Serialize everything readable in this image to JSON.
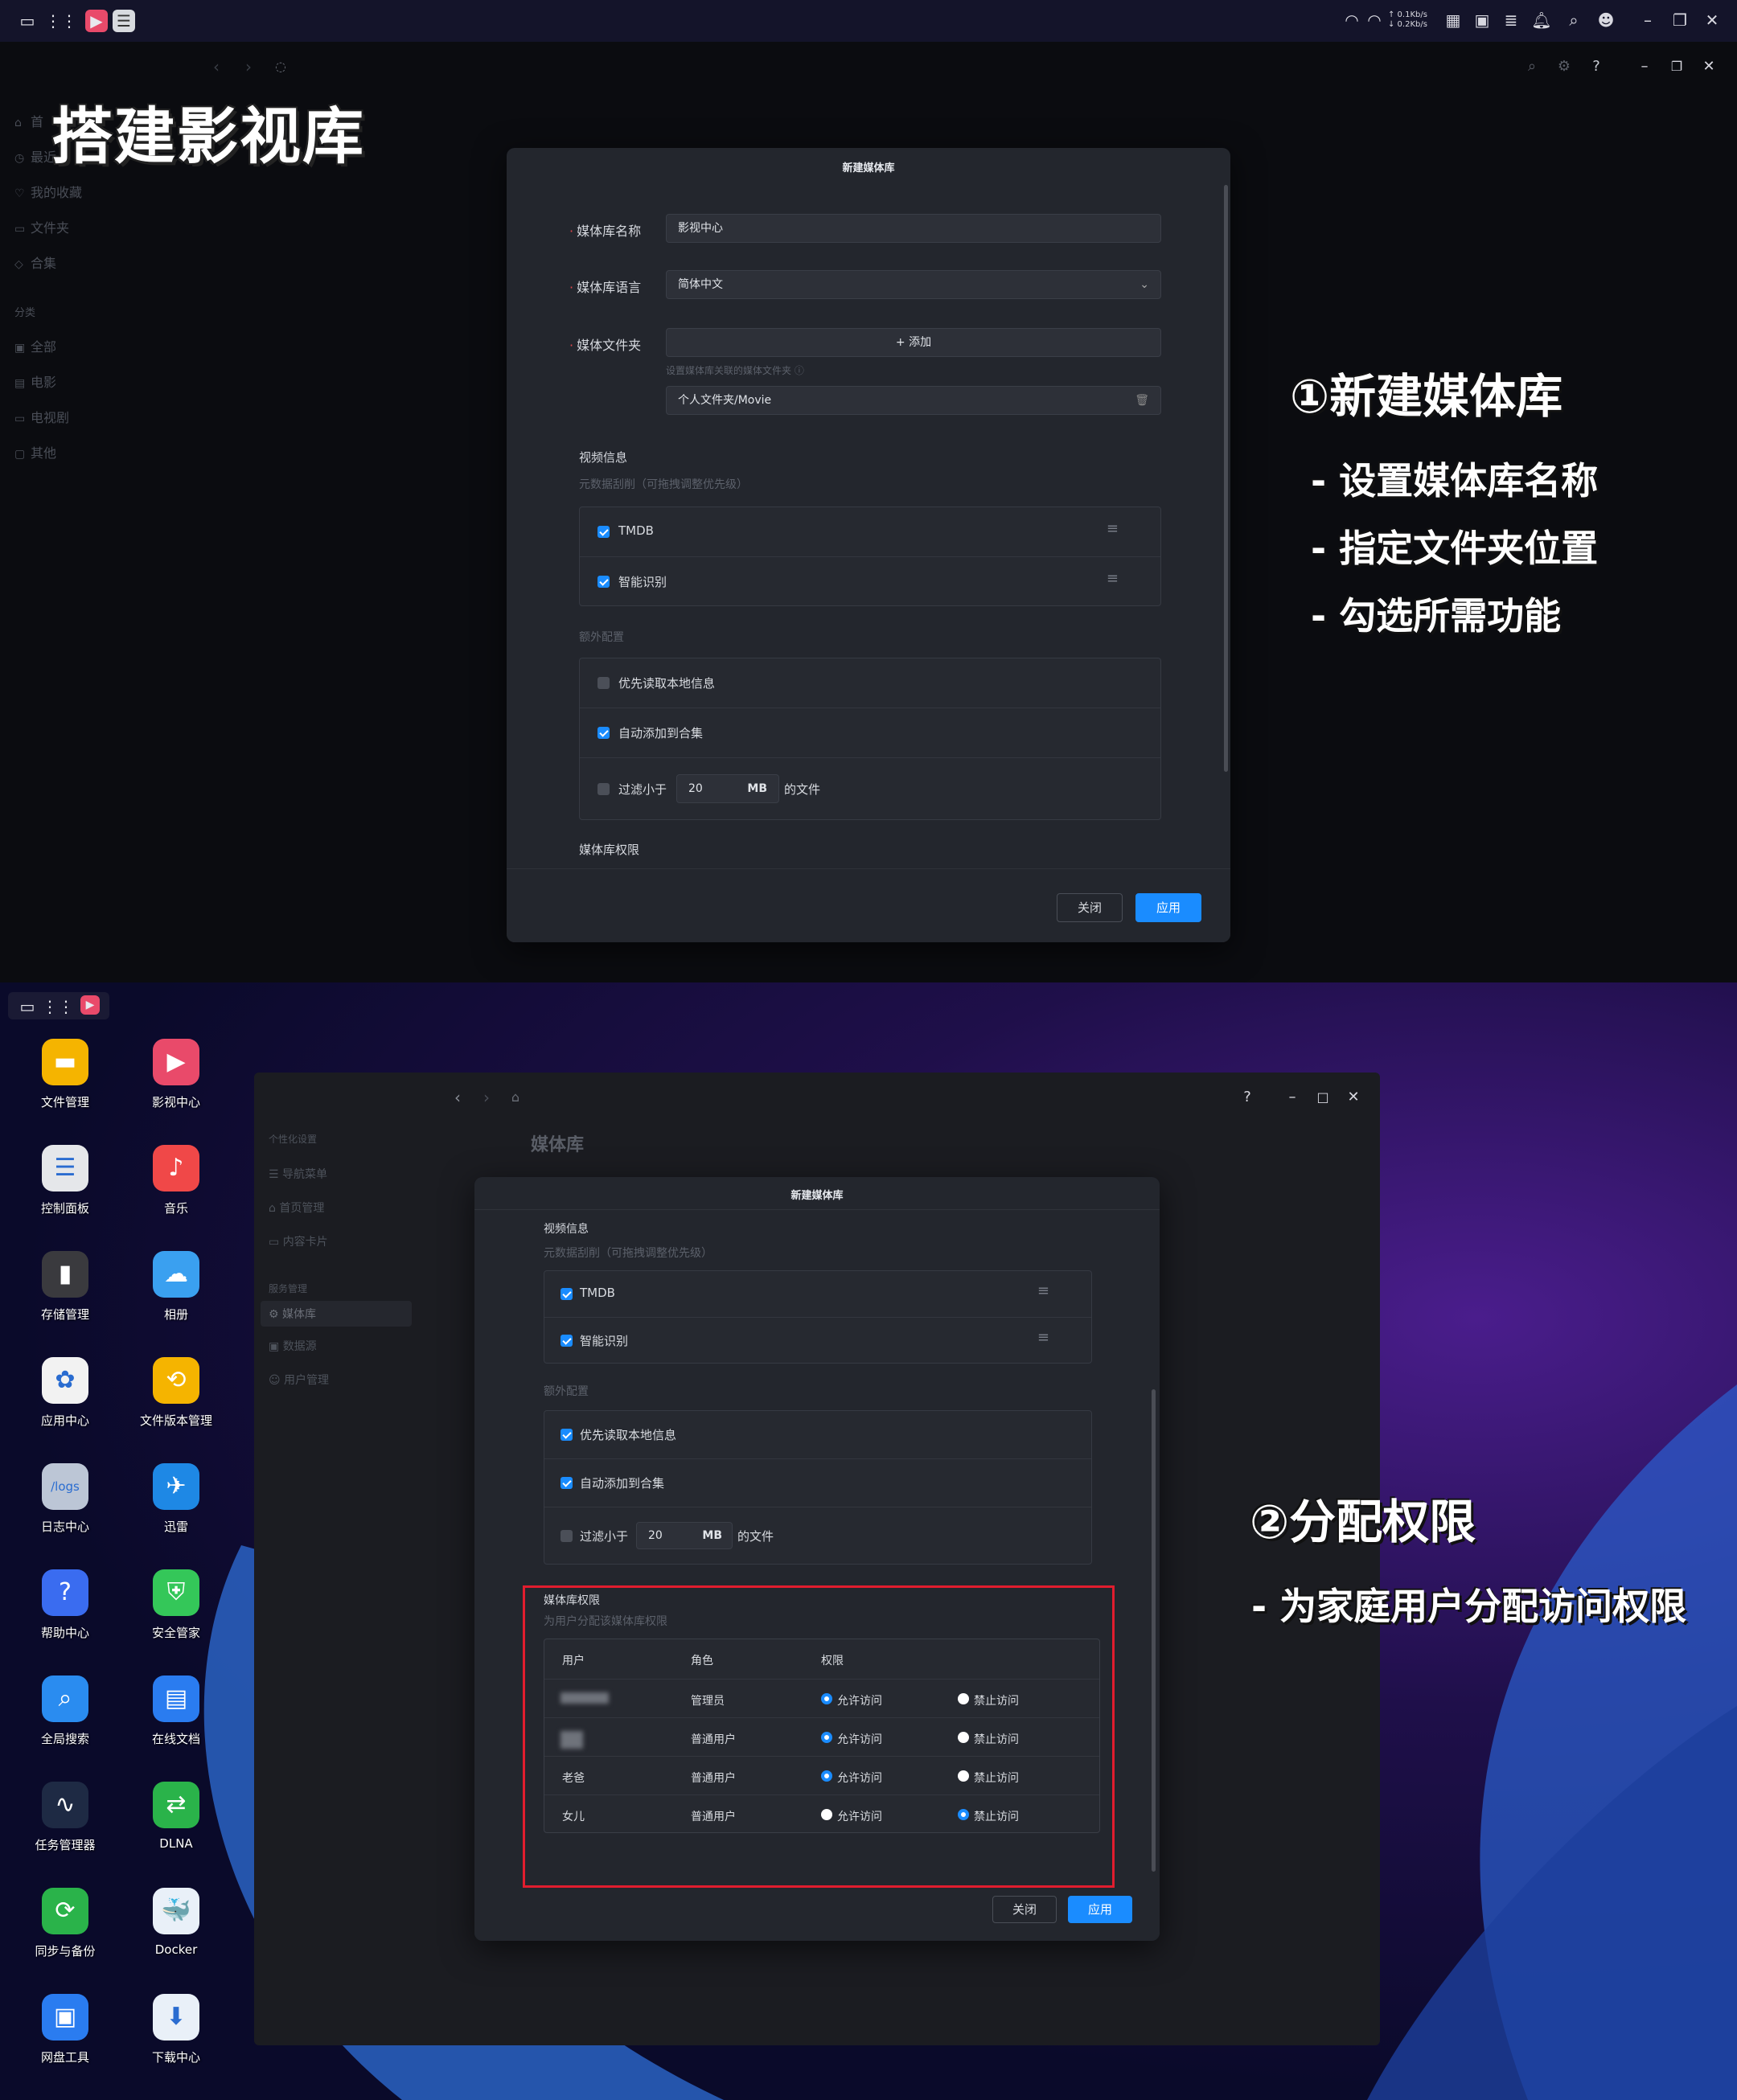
{
  "overlay": {
    "title": "搭建影视库",
    "step1_title": "①新建媒体库",
    "step1_bullets": [
      "- 设置媒体库名称",
      "- 指定文件夹位置",
      "- 勾选所需功能"
    ],
    "step2_title": "②分配权限",
    "step2_bullets": [
      "- 为家庭用户分配访问权限"
    ]
  },
  "taskbar": {
    "net_up": "↑ 0.1Kb/s",
    "net_down": "↓ 0.2Kb/s"
  },
  "panel1_sidebar": {
    "items": [
      "首",
      "最近",
      "我的收藏",
      "文件夹",
      "合集"
    ],
    "section": "分类",
    "categories": [
      "全部",
      "电影",
      "电视剧",
      "其他"
    ]
  },
  "dialog": {
    "title": "新建媒体库",
    "name_label": "媒体库名称",
    "name_value": "影视中心",
    "lang_label": "媒体库语言",
    "lang_value": "简体中文",
    "folder_label": "媒体文件夹",
    "add_label": "+ 添加",
    "folder_hint": "设置媒体库关联的媒体文件夹 ⓘ",
    "folder_path": "个人文件夹/Movie",
    "video_info": "视频信息",
    "scrape_hint": "元数据刮削（可拖拽调整优先级）",
    "scrapers": [
      {
        "label": "TMDB",
        "checked": true
      },
      {
        "label": "智能识别",
        "checked": true
      }
    ],
    "extra": "额外配置",
    "extra_items_1": [
      {
        "label": "优先读取本地信息",
        "checked": false
      },
      {
        "label": "自动添加到合集",
        "checked": true
      }
    ],
    "extra_items_2": [
      {
        "label": "优先读取本地信息",
        "checked": true
      },
      {
        "label": "自动添加到合集",
        "checked": true
      }
    ],
    "filter_prefix": "过滤小于",
    "filter_value": "20",
    "filter_unit": "MB",
    "filter_suffix": "的文件",
    "perm_title": "媒体库权限",
    "perm_sub": "为用户分配该媒体库权限",
    "close": "关闭",
    "apply": "应用"
  },
  "desktop_icons": [
    {
      "label": "文件管理",
      "icon": "folder-icon",
      "color": "#f5b400",
      "glyph": "▬"
    },
    {
      "label": "影视中心",
      "icon": "video-icon",
      "color": "#e94a6a",
      "glyph": "▶"
    },
    {
      "label": "控制面板",
      "icon": "control-panel-icon",
      "color": "#e5e7ea",
      "glyph": "☰"
    },
    {
      "label": "音乐",
      "icon": "music-icon",
      "color": "#f04848",
      "glyph": "♪"
    },
    {
      "label": "存储管理",
      "icon": "storage-icon",
      "color": "#3a3a3e",
      "glyph": "▮"
    },
    {
      "label": "相册",
      "icon": "photo-icon",
      "color": "#3aa0f0",
      "glyph": "☁"
    },
    {
      "label": "应用中心",
      "icon": "app-center-icon",
      "color": "#f2f2f2",
      "glyph": "✿"
    },
    {
      "label": "文件版本管理",
      "icon": "version-icon",
      "color": "#f5b400",
      "glyph": "⟲"
    },
    {
      "label": "日志中心",
      "icon": "log-icon",
      "color": "#bcc6d6",
      "glyph": "/logs"
    },
    {
      "label": "迅雷",
      "icon": "thunder-icon",
      "color": "#1e88e5",
      "glyph": "✈"
    },
    {
      "label": "帮助中心",
      "icon": "help-icon",
      "color": "#3a6cf0",
      "glyph": "?"
    },
    {
      "label": "安全管家",
      "icon": "security-icon",
      "color": "#34c759",
      "glyph": "⛨"
    },
    {
      "label": "全局搜索",
      "icon": "search-icon",
      "color": "#2a8cf0",
      "glyph": "⌕"
    },
    {
      "label": "在线文档",
      "icon": "doc-icon",
      "color": "#2a7cf0",
      "glyph": "▤"
    },
    {
      "label": "任务管理器",
      "icon": "task-manager-icon",
      "color": "#1e2a44",
      "glyph": "∿"
    },
    {
      "label": "DLNA",
      "icon": "dlna-icon",
      "color": "#2ab34a",
      "glyph": "⇄"
    },
    {
      "label": "同步与备份",
      "icon": "sync-icon",
      "color": "#2ab34a",
      "glyph": "⟳"
    },
    {
      "label": "Docker",
      "icon": "docker-icon",
      "color": "#e9f0f8",
      "glyph": "🐳"
    },
    {
      "label": "网盘工具",
      "icon": "cloud-drive-icon",
      "color": "#2a7cf0",
      "glyph": "▣"
    },
    {
      "label": "下载中心",
      "icon": "download-icon",
      "color": "#e9f0f8",
      "glyph": "⬇"
    }
  ],
  "win2": {
    "page_title": "媒体库",
    "side_section1": "个性化设置",
    "side_items1": [
      "导航菜单",
      "首页管理",
      "内容卡片"
    ],
    "side_section2": "服务管理",
    "side_items2": [
      "媒体库",
      "数据源",
      "用户管理"
    ]
  },
  "perm_table": {
    "headers": [
      "用户",
      "角色",
      "权限"
    ],
    "rows": [
      {
        "user": "",
        "role": "管理员",
        "allow": true
      },
      {
        "user": "",
        "role": "普通用户",
        "allow": true
      },
      {
        "user": "老爸",
        "role": "普通用户",
        "allow": true
      },
      {
        "user": "女儿",
        "role": "普通用户",
        "allow": false
      }
    ],
    "allow_label": "允许访问",
    "deny_label": "禁止访问"
  }
}
